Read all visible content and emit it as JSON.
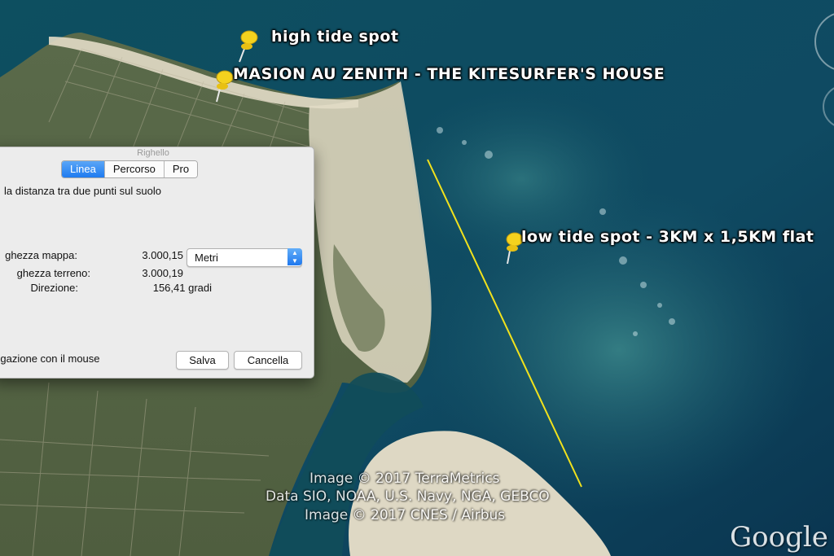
{
  "map": {
    "placemarks": [
      {
        "label": "high tide spot"
      },
      {
        "label": "MASION AU ZENITH - THE KITESURFER'S HOUSE"
      },
      {
        "label": "low tide spot - 3KM  x 1,5KM  flat"
      }
    ],
    "attribution": {
      "line1": "Image © 2017 TerraMetrics",
      "line2": "Data SIO, NOAA, U.S. Navy, NGA, GEBCO",
      "line3": "Image © 2017 CNES / Airbus"
    },
    "logo": "Google e",
    "measure_line_color": "#f2e21c"
  },
  "dialog": {
    "title": "Righello",
    "tabs": [
      {
        "label": "Linea",
        "active": true
      },
      {
        "label": "Percorso",
        "active": false
      },
      {
        "label": "Pro",
        "active": false
      }
    ],
    "description": "la distanza tra due punti sul suolo",
    "map_length_label": "ghezza mappa:",
    "map_length_value": "3.000,15",
    "ground_length_label": "ghezza terreno:",
    "ground_length_value": "3.000,19",
    "heading_label": "Direzione:",
    "heading_value": "156,41 gradi",
    "unit_selected": "Metri",
    "mouse_nav_label": "vigazione con il mouse",
    "save_label": "Salva",
    "cancel_label": "Cancella"
  }
}
